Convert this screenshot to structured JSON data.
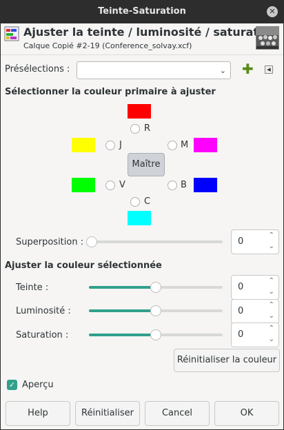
{
  "titlebar": {
    "title": "Teinte-Saturation",
    "close_glyph": "✕"
  },
  "header": {
    "title": "Ajuster la teinte / luminosité / saturation",
    "subtitle": "Calque Copié #2-19 (Conference_solvay.xcf)"
  },
  "presets": {
    "label": "Présélections :",
    "value": "",
    "add_glyph": "✚",
    "menu_glyph": "◀",
    "arrow_glyph": "⌄"
  },
  "primary": {
    "heading": "Sélectionner la couleur primaire à ajuster",
    "colors": {
      "R": "#ff0000",
      "J": "#ffff00",
      "M": "#ff00ff",
      "V": "#00ff00",
      "B": "#0000ff",
      "C": "#00ffff"
    },
    "labels": {
      "R": "R",
      "J": "J",
      "M": "M",
      "V": "V",
      "B": "B",
      "C": "C"
    },
    "master_label": "Maître"
  },
  "overlap": {
    "label": "Superposition :",
    "value": "0",
    "level": 0
  },
  "adjust": {
    "heading": "Ajuster la couleur sélectionnée",
    "hue": {
      "label": "Teinte :",
      "value": "0",
      "level": 0.5
    },
    "lightness": {
      "label": "Luminosité :",
      "value": "0",
      "level": 0.5
    },
    "saturation": {
      "label": "Saturation :",
      "value": "0",
      "level": 0.5
    },
    "reset_color_label": "Réinitialiser la couleur"
  },
  "preview": {
    "label": "Aperçu",
    "checked": true,
    "check_glyph": "✓"
  },
  "buttons": {
    "help": "Help",
    "reset": "Réinitialiser",
    "cancel": "Cancel",
    "ok": "OK"
  },
  "spin_glyphs": {
    "up": "⌃",
    "down": "⌄"
  },
  "accent_color": "#30a08c"
}
